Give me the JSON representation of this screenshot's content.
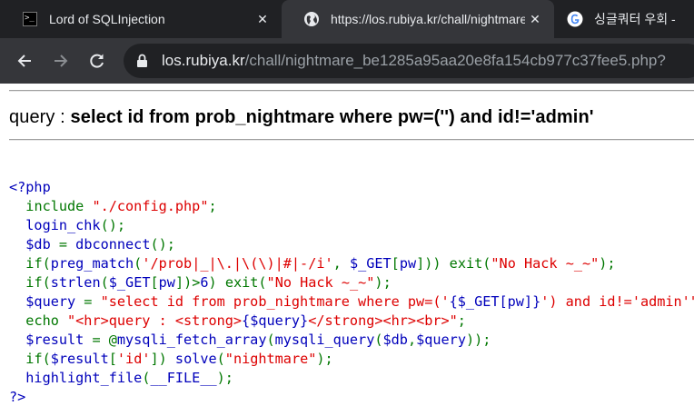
{
  "tabs": [
    {
      "title": "Lord of SQLInjection",
      "icon": "terminal-icon",
      "active": false
    },
    {
      "title": "https://los.rubiya.kr/chall/nightmare",
      "icon": "globe-icon",
      "active": true
    },
    {
      "title": "싱글쿼터 우회 -",
      "icon": "google-icon",
      "active": false
    }
  ],
  "close_glyph": "✕",
  "toolbar": {
    "back_icon": "arrow-left-icon",
    "forward_icon": "arrow-right-icon",
    "reload_icon": "reload-icon",
    "lock_icon": "lock-icon",
    "url_host": "los.rubiya.kr",
    "url_path": "/chall/nightmare_be1285a95aa20e8fa154cb977c37fee5.php?"
  },
  "page": {
    "query_prefix": "query : ",
    "query_sql": "select id from prob_nightmare where pw=('') and id!='admin'",
    "source_lines": [
      [
        {
          "t": "<?php",
          "c": "def"
        }
      ],
      [
        {
          "t": "  ",
          "c": "def"
        },
        {
          "t": "include ",
          "c": "kw"
        },
        {
          "t": "\"./config.php\"",
          "c": "str"
        },
        {
          "t": ";",
          "c": "kw"
        }
      ],
      [
        {
          "t": "  login_chk",
          "c": "def"
        },
        {
          "t": "();",
          "c": "kw"
        }
      ],
      [
        {
          "t": "  $db ",
          "c": "def"
        },
        {
          "t": "= ",
          "c": "kw"
        },
        {
          "t": "dbconnect",
          "c": "def"
        },
        {
          "t": "();",
          "c": "kw"
        }
      ],
      [
        {
          "t": "  ",
          "c": "def"
        },
        {
          "t": "if(",
          "c": "kw"
        },
        {
          "t": "preg_match",
          "c": "def"
        },
        {
          "t": "(",
          "c": "kw"
        },
        {
          "t": "'/prob|_|\\.|\\(\\)|#|-/i'",
          "c": "str"
        },
        {
          "t": ", ",
          "c": "kw"
        },
        {
          "t": "$_GET",
          "c": "def"
        },
        {
          "t": "[",
          "c": "kw"
        },
        {
          "t": "pw",
          "c": "def"
        },
        {
          "t": "])) exit(",
          "c": "kw"
        },
        {
          "t": "\"No Hack ~_~\"",
          "c": "str"
        },
        {
          "t": ");",
          "c": "kw"
        }
      ],
      [
        {
          "t": "  ",
          "c": "def"
        },
        {
          "t": "if(",
          "c": "kw"
        },
        {
          "t": "strlen",
          "c": "def"
        },
        {
          "t": "(",
          "c": "kw"
        },
        {
          "t": "$_GET",
          "c": "def"
        },
        {
          "t": "[",
          "c": "kw"
        },
        {
          "t": "pw",
          "c": "def"
        },
        {
          "t": "])>",
          "c": "kw"
        },
        {
          "t": "6",
          "c": "def"
        },
        {
          "t": ") exit(",
          "c": "kw"
        },
        {
          "t": "\"No Hack ~_~\"",
          "c": "str"
        },
        {
          "t": ");",
          "c": "kw"
        }
      ],
      [
        {
          "t": "  $query ",
          "c": "def"
        },
        {
          "t": "= ",
          "c": "kw"
        },
        {
          "t": "\"select id from prob_nightmare where pw=('",
          "c": "str"
        },
        {
          "t": "{$_GET[pw]}",
          "c": "def"
        },
        {
          "t": "') and id!='admin'\"",
          "c": "str"
        },
        {
          "t": ";",
          "c": "kw"
        }
      ],
      [
        {
          "t": "  ",
          "c": "def"
        },
        {
          "t": "echo ",
          "c": "kw"
        },
        {
          "t": "\"<hr>query : <strong>",
          "c": "str"
        },
        {
          "t": "{$query}",
          "c": "def"
        },
        {
          "t": "</strong><hr><br>\"",
          "c": "str"
        },
        {
          "t": ";",
          "c": "kw"
        }
      ],
      [
        {
          "t": "  $result ",
          "c": "def"
        },
        {
          "t": "= @",
          "c": "kw"
        },
        {
          "t": "mysqli_fetch_array",
          "c": "def"
        },
        {
          "t": "(",
          "c": "kw"
        },
        {
          "t": "mysqli_query",
          "c": "def"
        },
        {
          "t": "(",
          "c": "kw"
        },
        {
          "t": "$db",
          "c": "def"
        },
        {
          "t": ",",
          "c": "kw"
        },
        {
          "t": "$query",
          "c": "def"
        },
        {
          "t": "));",
          "c": "kw"
        }
      ],
      [
        {
          "t": "  ",
          "c": "def"
        },
        {
          "t": "if(",
          "c": "kw"
        },
        {
          "t": "$result",
          "c": "def"
        },
        {
          "t": "[",
          "c": "kw"
        },
        {
          "t": "'id'",
          "c": "str"
        },
        {
          "t": "]) ",
          "c": "kw"
        },
        {
          "t": "solve",
          "c": "def"
        },
        {
          "t": "(",
          "c": "kw"
        },
        {
          "t": "\"nightmare\"",
          "c": "str"
        },
        {
          "t": ");",
          "c": "kw"
        }
      ],
      [
        {
          "t": "  highlight_file",
          "c": "def"
        },
        {
          "t": "(",
          "c": "kw"
        },
        {
          "t": "__FILE__",
          "c": "def"
        },
        {
          "t": ");",
          "c": "kw"
        }
      ],
      [
        {
          "t": "?>",
          "c": "def"
        }
      ]
    ]
  }
}
